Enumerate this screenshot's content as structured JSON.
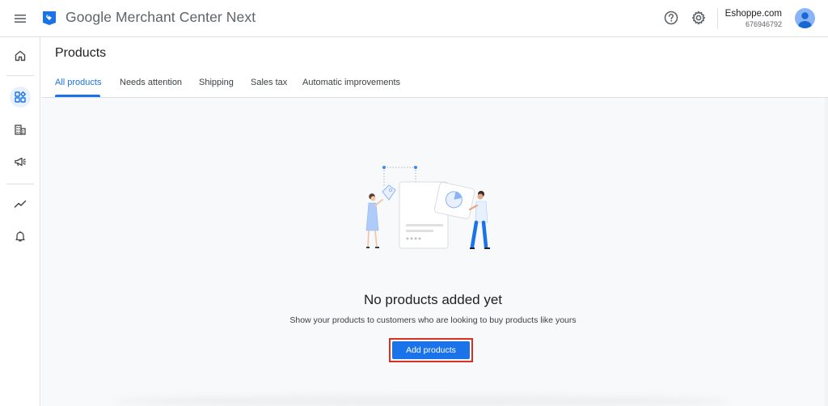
{
  "header": {
    "app_title": "Google Merchant Center Next",
    "account_name": "Eshoppe.com",
    "account_id": "676946792",
    "icons": [
      "menu-icon",
      "merchant-center-logo-icon",
      "help-icon",
      "gear-icon",
      "avatar"
    ]
  },
  "sidebar": {
    "items": [
      {
        "name": "home",
        "icon": "home-icon"
      },
      {
        "name": "products",
        "icon": "products-grid-icon",
        "active": true
      },
      {
        "name": "business",
        "icon": "business-icon"
      },
      {
        "name": "marketing",
        "icon": "megaphone-icon"
      },
      {
        "name": "performance",
        "icon": "trending-icon"
      },
      {
        "name": "notifications",
        "icon": "bell-icon"
      }
    ]
  },
  "page": {
    "title": "Products",
    "tabs": [
      {
        "label": "All products",
        "active": true
      },
      {
        "label": "Needs attention"
      },
      {
        "label": "Shipping"
      },
      {
        "label": "Sales tax"
      },
      {
        "label": "Automatic improvements"
      }
    ]
  },
  "empty_state": {
    "title": "No products added yet",
    "subtitle": "Show your products to customers who are looking to buy products like yours",
    "button_label": "Add products"
  },
  "colors": {
    "accent": "#1a73e8",
    "highlight_border": "#d93025",
    "content_bg": "#f8f9fa"
  }
}
